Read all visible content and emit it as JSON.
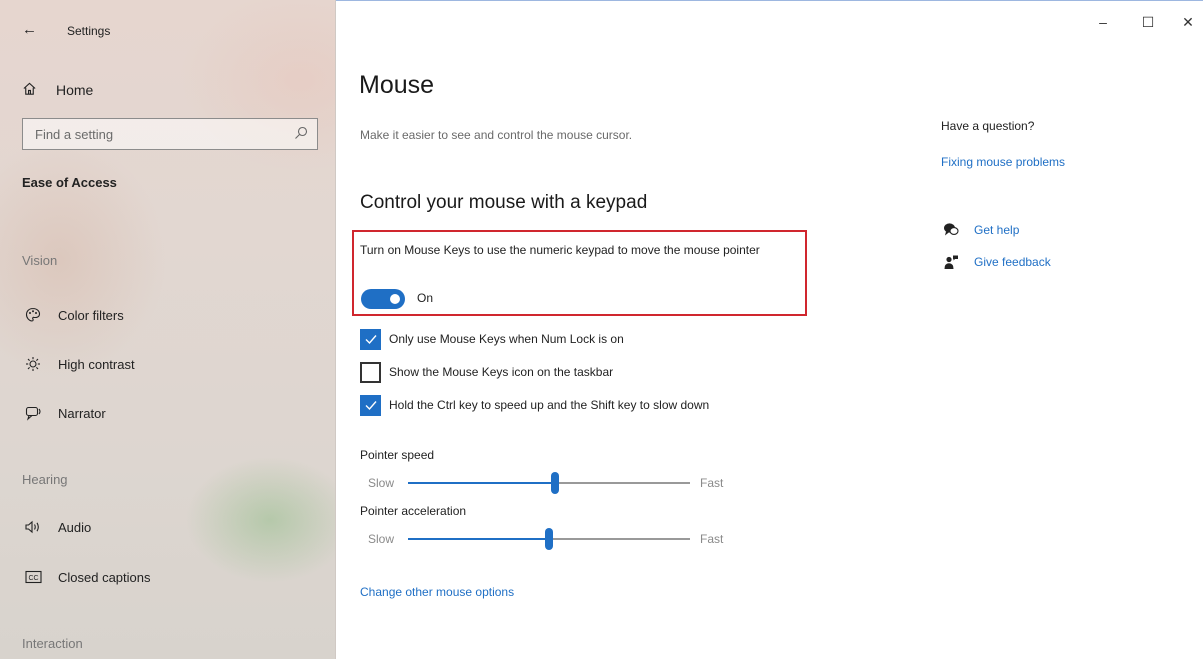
{
  "window": {
    "app_title": "Settings",
    "controls": {
      "minimize": "–",
      "maximize": "☐",
      "close": "✕"
    }
  },
  "sidebar": {
    "home_label": "Home",
    "search_placeholder": "Find a setting",
    "section_title": "Ease of Access",
    "groups": {
      "vision": "Vision",
      "hearing": "Hearing",
      "interaction": "Interaction"
    },
    "items": [
      {
        "label": "Color filters",
        "icon": "color-filters-icon"
      },
      {
        "label": "High contrast",
        "icon": "high-contrast-icon"
      },
      {
        "label": "Narrator",
        "icon": "narrator-icon"
      },
      {
        "label": "Audio",
        "icon": "audio-icon"
      },
      {
        "label": "Closed captions",
        "icon": "closed-captions-icon"
      }
    ]
  },
  "main": {
    "title": "Mouse",
    "subtitle": "Make it easier to see and control the mouse cursor.",
    "section_heading": "Control your mouse with a keypad",
    "mouse_keys_description": "Turn on Mouse Keys to use the numeric keypad to move the mouse pointer",
    "mouse_keys_toggle": {
      "state_label": "On",
      "on": true
    },
    "checkboxes": [
      {
        "label": "Only use Mouse Keys when Num Lock is on",
        "checked": true
      },
      {
        "label": "Show the Mouse Keys icon on the taskbar",
        "checked": false
      },
      {
        "label": "Hold the Ctrl key to speed up and the Shift key to slow down",
        "checked": true
      }
    ],
    "pointer_speed": {
      "label": "Pointer speed",
      "min_label": "Slow",
      "max_label": "Fast",
      "value_fraction": 0.52
    },
    "pointer_acceleration": {
      "label": "Pointer acceleration",
      "min_label": "Slow",
      "max_label": "Fast",
      "value_fraction": 0.5
    },
    "change_other_link": "Change other mouse options"
  },
  "help_panel": {
    "question": "Have a question?",
    "fix_link": "Fixing mouse problems",
    "get_help": "Get help",
    "give_feedback": "Give feedback"
  },
  "colors": {
    "accent": "#1f6fc5",
    "highlight_border": "#d0262e"
  }
}
